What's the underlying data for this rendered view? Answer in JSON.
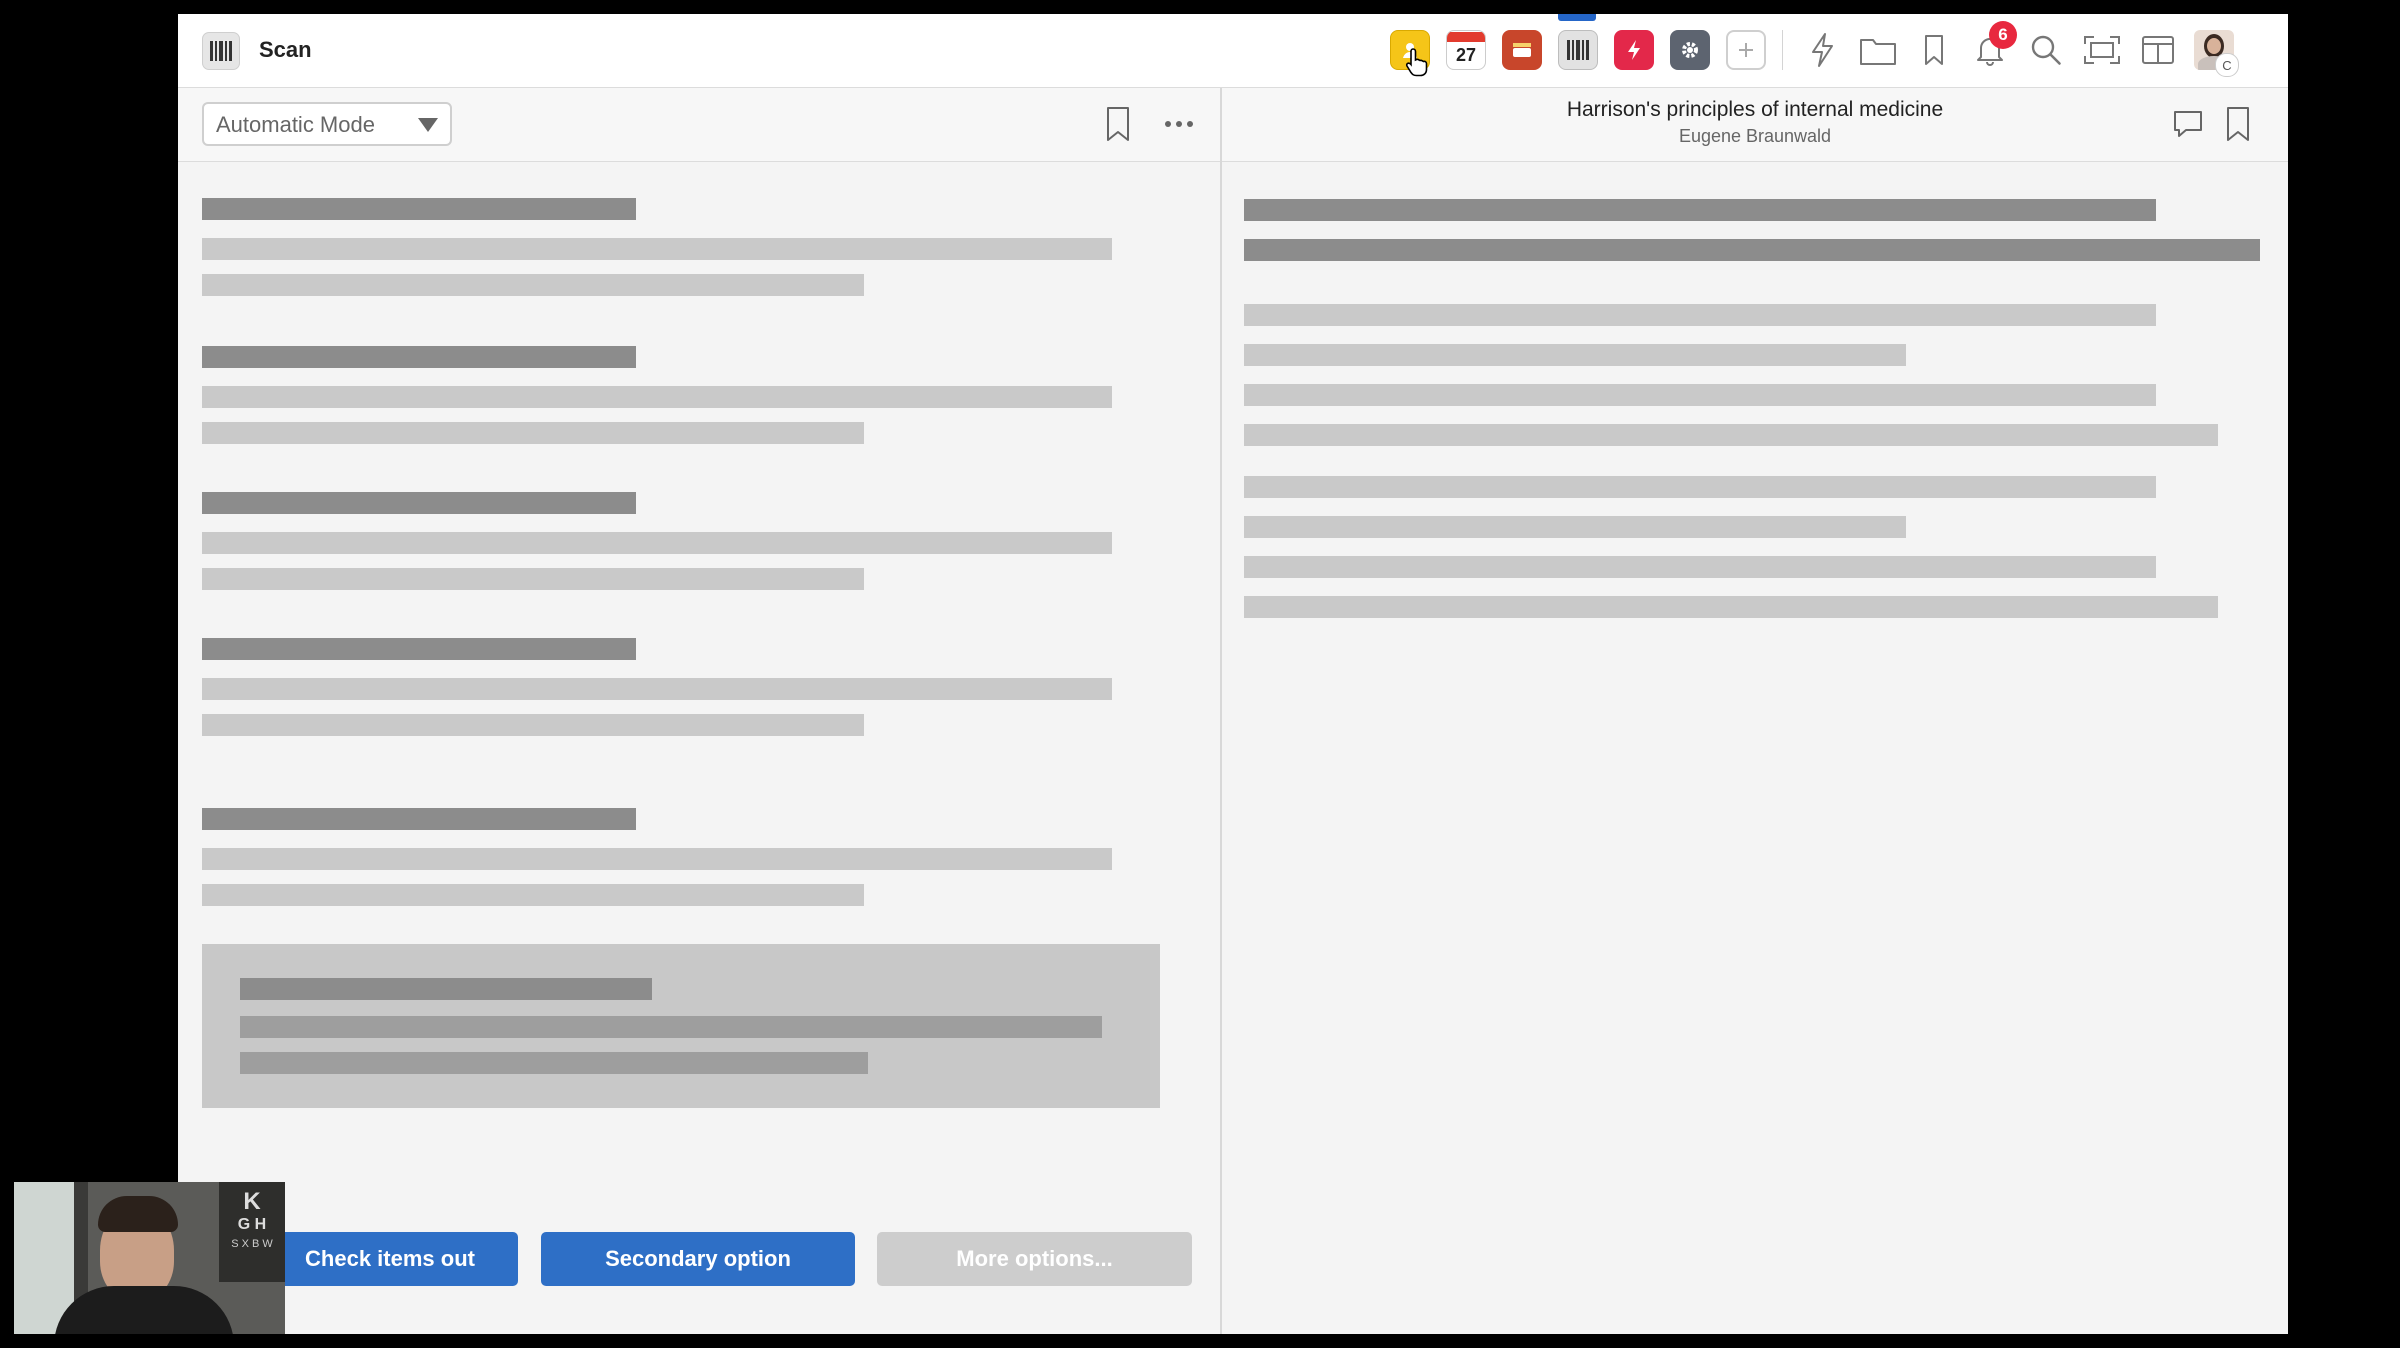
{
  "app": {
    "title": "Scan",
    "notification_count": "6",
    "avatar_initial": "C",
    "calendar_day": "27"
  },
  "toolbar": {
    "tiles": [
      "contacts-app-tile",
      "calendar-app-tile",
      "inbox-app-tile",
      "scan-app-tile",
      "flash-app-tile",
      "settings-app-tile",
      "add-app-tile"
    ],
    "tools": [
      "lightning-icon",
      "folder-icon",
      "bookmark-icon",
      "bell-icon",
      "search-icon",
      "fullscreen-icon",
      "layout-icon"
    ]
  },
  "left_pane": {
    "mode_select": {
      "value": "Automatic Mode"
    }
  },
  "right_pane": {
    "title": "Harrison's principles of internal medicine",
    "author": "Eugene Braunwald"
  },
  "buttons": {
    "primary": "Check items out",
    "secondary": "Secondary option",
    "more": "More options..."
  },
  "colors": {
    "accent": "#2e6fc6",
    "badge": "#e8283f"
  }
}
